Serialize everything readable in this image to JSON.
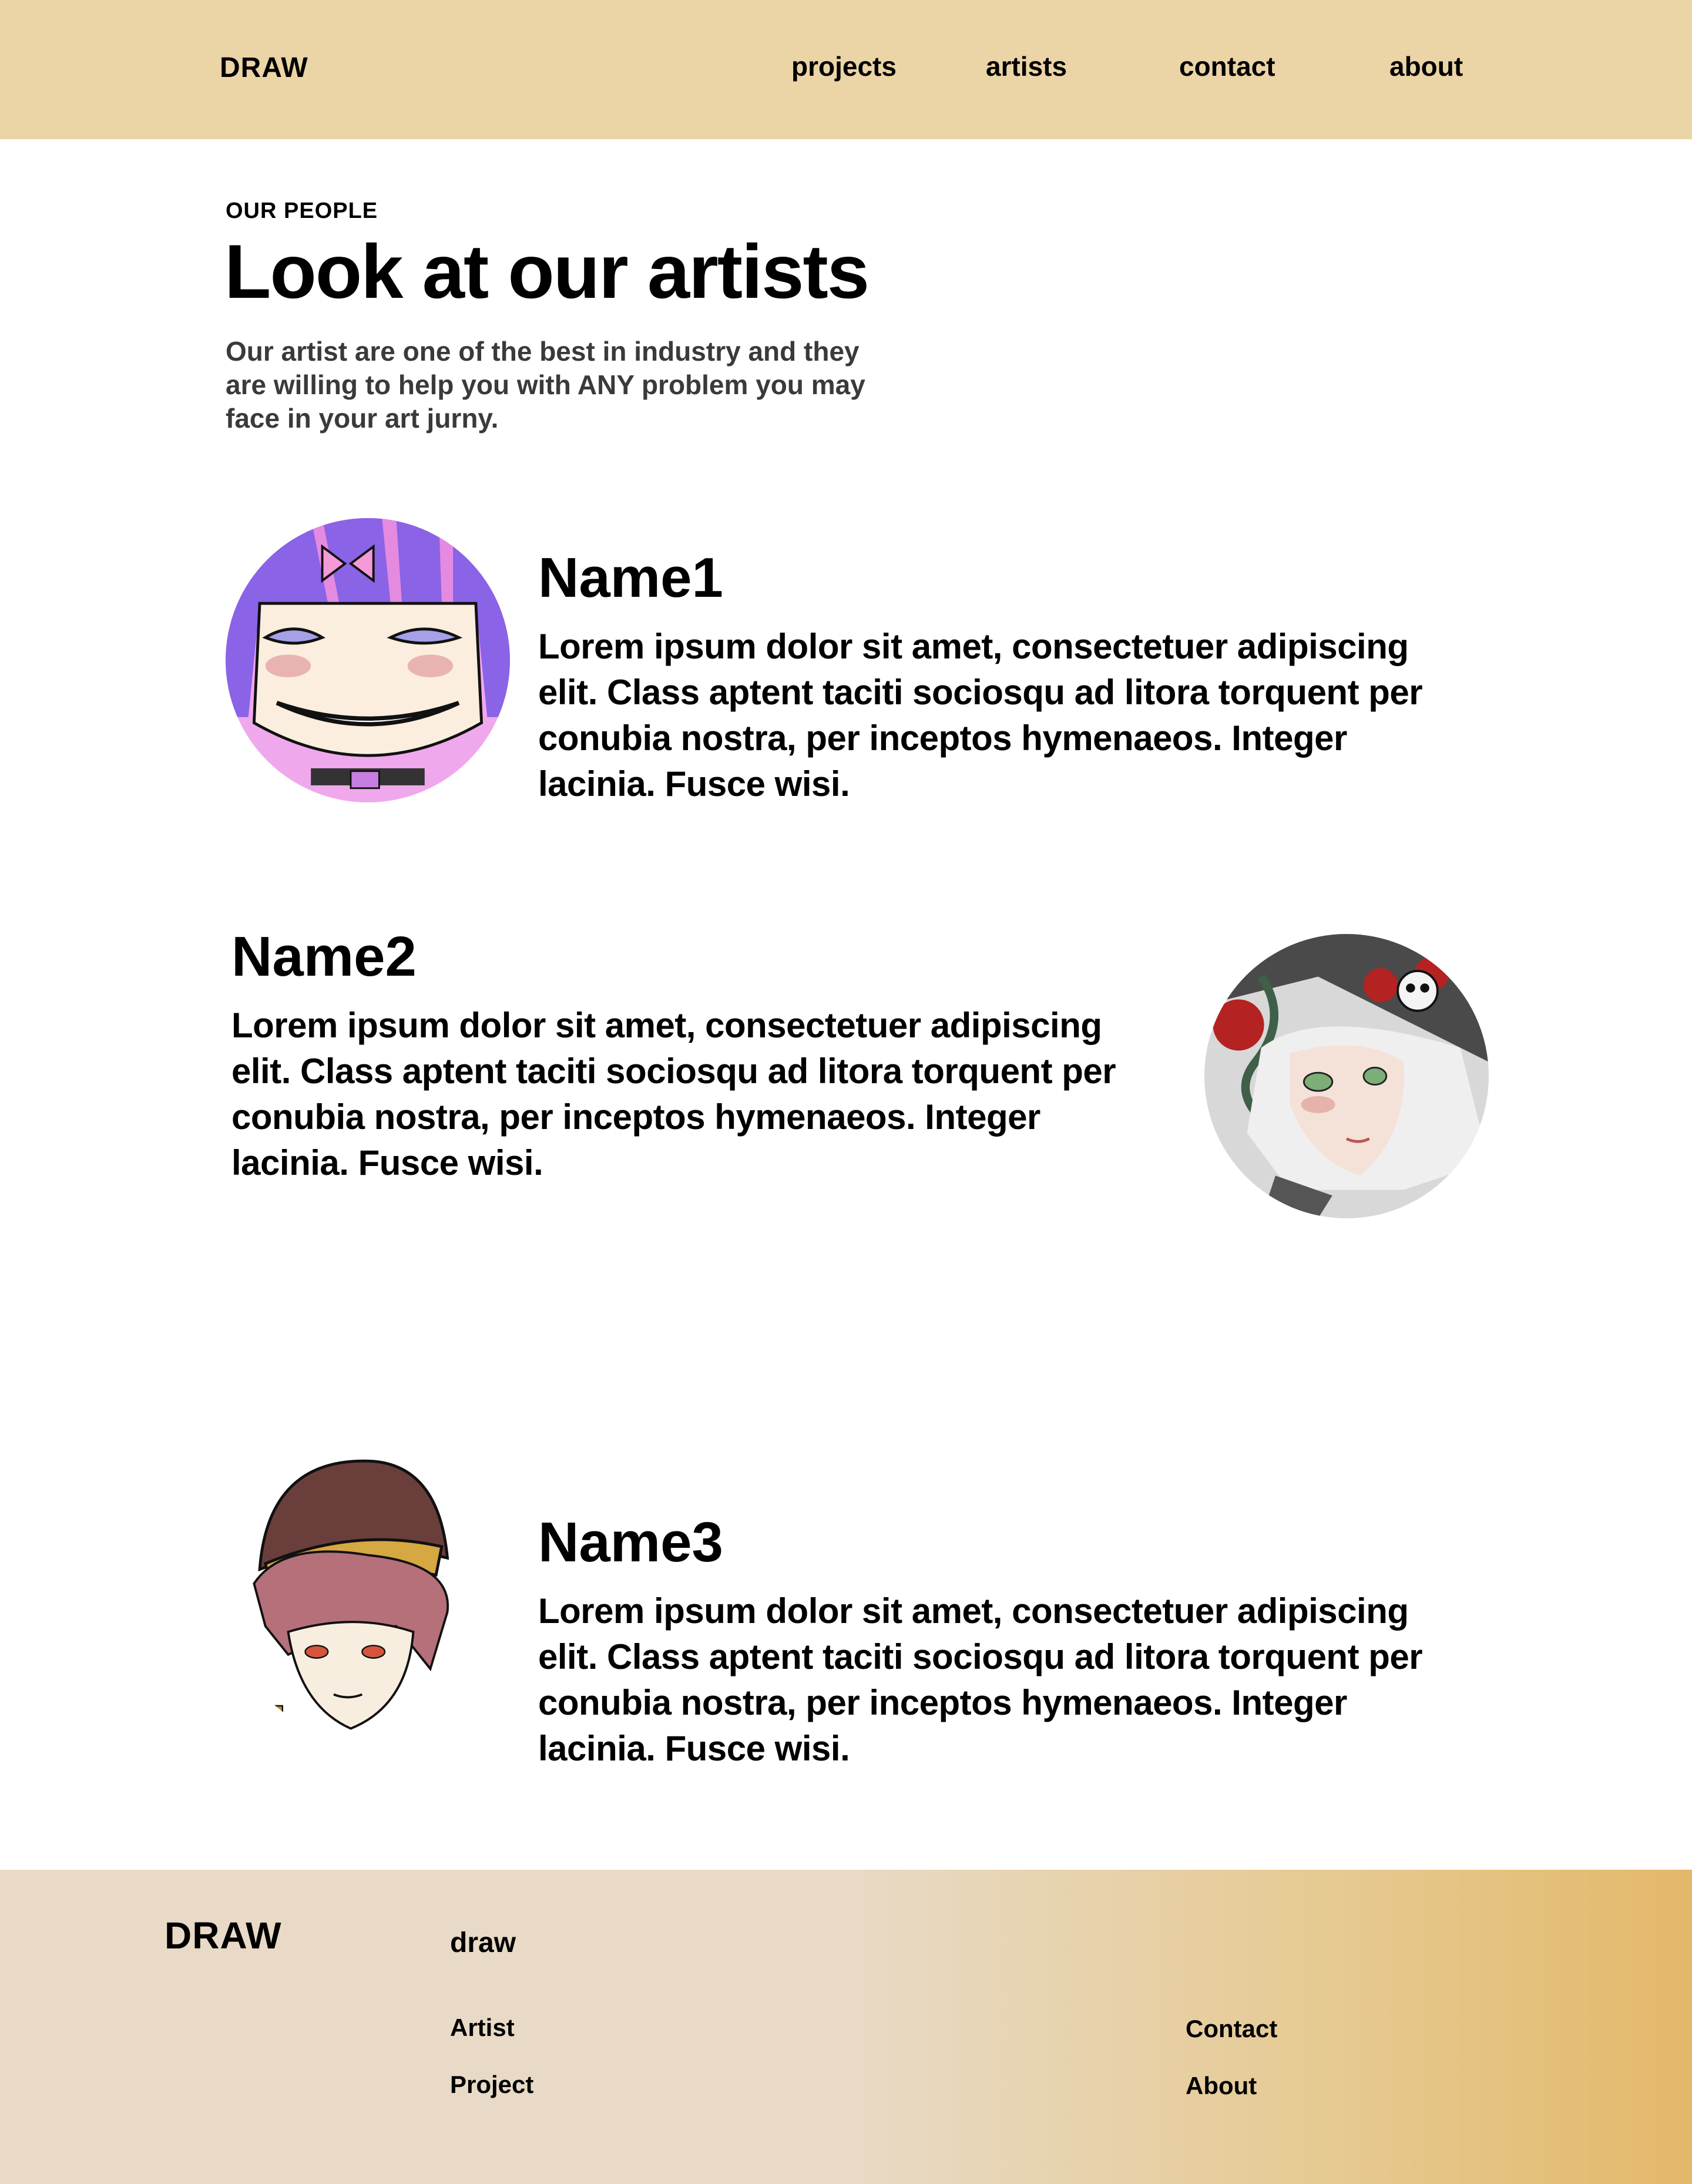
{
  "header": {
    "logo": "DRAW",
    "nav": {
      "projects": "projects",
      "artists": "artists",
      "contact": "contact",
      "about": "about"
    }
  },
  "intro": {
    "eyebrow": "OUR PEOPLE",
    "title": "Look at our artists",
    "description": "Our artist are one of the best in industry and they are willing to help you with ANY problem you may face in your art jurny."
  },
  "artists": [
    {
      "name": "Name1",
      "bio": "Lorem ipsum dolor sit amet, consectetuer adipiscing elit. Class aptent taciti sociosqu ad litora torquent per conubia nostra, per inceptos hymenaeos. Integer lacinia. Fusce wisi."
    },
    {
      "name": "Name2",
      "bio": "Lorem ipsum dolor sit amet, consectetuer adipiscing elit. Class aptent taciti sociosqu ad litora torquent per conubia nostra, per inceptos hymenaeos. Integer lacinia. Fusce wisi."
    },
    {
      "name": "Name3",
      "bio": "Lorem ipsum dolor sit amet, consectetuer adipiscing elit. Class aptent taciti sociosqu ad litora torquent per conubia nostra, per inceptos hymenaeos. Integer lacinia. Fusce wisi."
    }
  ],
  "footer": {
    "logo": "DRAW",
    "heading": "draw",
    "links": {
      "artist": "Artist",
      "project": "Project",
      "contact": "Contact",
      "about": "About"
    }
  },
  "colors": {
    "header_bg": "#ebd4a6",
    "footer_bg_start": "#e8dac6",
    "footer_bg_end": "#e3b86a",
    "text": "#000000",
    "intro_text": "#3a3a3a"
  }
}
